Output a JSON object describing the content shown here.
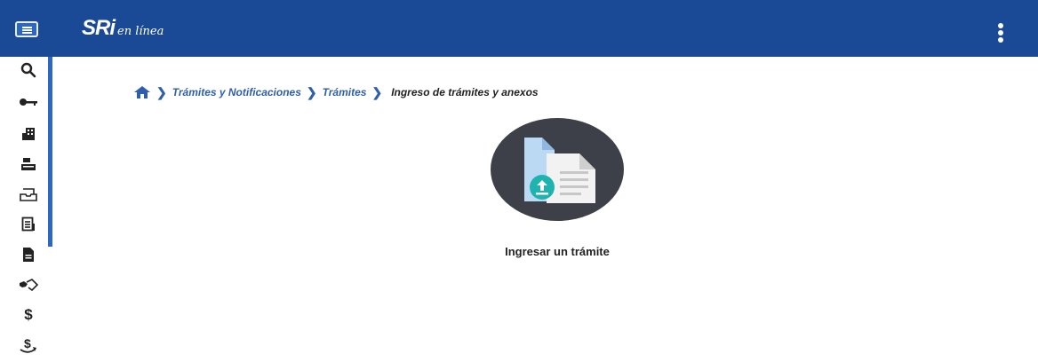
{
  "header": {
    "brand": "SRi",
    "brand_sub": "en línea"
  },
  "icons": {
    "menu": "hamburger-icon",
    "more": "more-vertical-icon",
    "home": "home-icon",
    "sidebar": [
      "search-icon",
      "key-icon",
      "building-icon",
      "cash-register-icon",
      "inbox-tray-icon",
      "receipt-icon",
      "document-icon",
      "handshake-icon",
      "dollar-icon",
      "dollar-return-icon"
    ]
  },
  "breadcrumb": {
    "items": [
      "Trámites y Notificaciones",
      "Trámites"
    ],
    "current": "Ingreso de trámites y anexos"
  },
  "main": {
    "action_label": "Ingresar un trámite"
  },
  "colors": {
    "header_bg": "#1a4a96",
    "accent": "#2e67c2",
    "upload_badge": "#1fb3b0",
    "illustration_bg": "#3d4048"
  }
}
